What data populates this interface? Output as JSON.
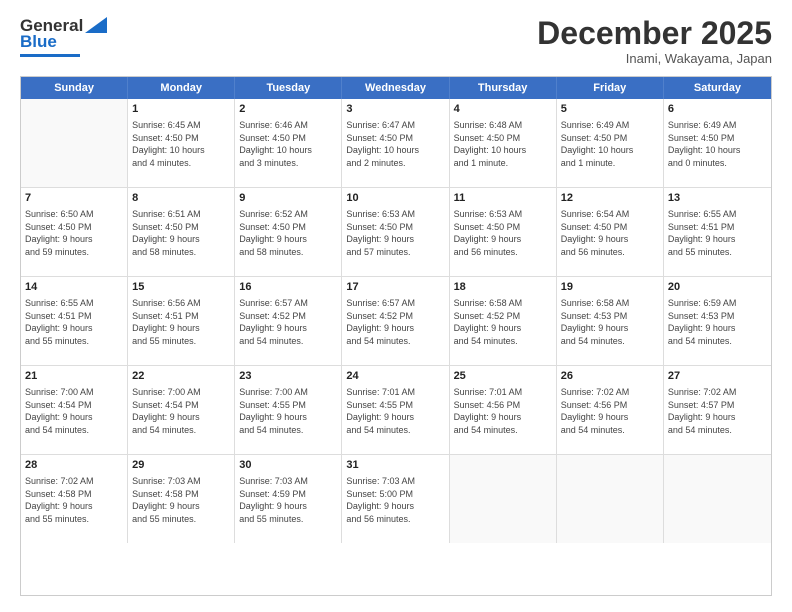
{
  "header": {
    "logo_general": "General",
    "logo_blue": "Blue",
    "month_title": "December 2025",
    "location": "Inami, Wakayama, Japan"
  },
  "weekdays": [
    "Sunday",
    "Monday",
    "Tuesday",
    "Wednesday",
    "Thursday",
    "Friday",
    "Saturday"
  ],
  "rows": [
    [
      {
        "day": "",
        "info": ""
      },
      {
        "day": "1",
        "info": "Sunrise: 6:45 AM\nSunset: 4:50 PM\nDaylight: 10 hours\nand 4 minutes."
      },
      {
        "day": "2",
        "info": "Sunrise: 6:46 AM\nSunset: 4:50 PM\nDaylight: 10 hours\nand 3 minutes."
      },
      {
        "day": "3",
        "info": "Sunrise: 6:47 AM\nSunset: 4:50 PM\nDaylight: 10 hours\nand 2 minutes."
      },
      {
        "day": "4",
        "info": "Sunrise: 6:48 AM\nSunset: 4:50 PM\nDaylight: 10 hours\nand 1 minute."
      },
      {
        "day": "5",
        "info": "Sunrise: 6:49 AM\nSunset: 4:50 PM\nDaylight: 10 hours\nand 1 minute."
      },
      {
        "day": "6",
        "info": "Sunrise: 6:49 AM\nSunset: 4:50 PM\nDaylight: 10 hours\nand 0 minutes."
      }
    ],
    [
      {
        "day": "7",
        "info": "Sunrise: 6:50 AM\nSunset: 4:50 PM\nDaylight: 9 hours\nand 59 minutes."
      },
      {
        "day": "8",
        "info": "Sunrise: 6:51 AM\nSunset: 4:50 PM\nDaylight: 9 hours\nand 58 minutes."
      },
      {
        "day": "9",
        "info": "Sunrise: 6:52 AM\nSunset: 4:50 PM\nDaylight: 9 hours\nand 58 minutes."
      },
      {
        "day": "10",
        "info": "Sunrise: 6:53 AM\nSunset: 4:50 PM\nDaylight: 9 hours\nand 57 minutes."
      },
      {
        "day": "11",
        "info": "Sunrise: 6:53 AM\nSunset: 4:50 PM\nDaylight: 9 hours\nand 56 minutes."
      },
      {
        "day": "12",
        "info": "Sunrise: 6:54 AM\nSunset: 4:50 PM\nDaylight: 9 hours\nand 56 minutes."
      },
      {
        "day": "13",
        "info": "Sunrise: 6:55 AM\nSunset: 4:51 PM\nDaylight: 9 hours\nand 55 minutes."
      }
    ],
    [
      {
        "day": "14",
        "info": "Sunrise: 6:55 AM\nSunset: 4:51 PM\nDaylight: 9 hours\nand 55 minutes."
      },
      {
        "day": "15",
        "info": "Sunrise: 6:56 AM\nSunset: 4:51 PM\nDaylight: 9 hours\nand 55 minutes."
      },
      {
        "day": "16",
        "info": "Sunrise: 6:57 AM\nSunset: 4:52 PM\nDaylight: 9 hours\nand 54 minutes."
      },
      {
        "day": "17",
        "info": "Sunrise: 6:57 AM\nSunset: 4:52 PM\nDaylight: 9 hours\nand 54 minutes."
      },
      {
        "day": "18",
        "info": "Sunrise: 6:58 AM\nSunset: 4:52 PM\nDaylight: 9 hours\nand 54 minutes."
      },
      {
        "day": "19",
        "info": "Sunrise: 6:58 AM\nSunset: 4:53 PM\nDaylight: 9 hours\nand 54 minutes."
      },
      {
        "day": "20",
        "info": "Sunrise: 6:59 AM\nSunset: 4:53 PM\nDaylight: 9 hours\nand 54 minutes."
      }
    ],
    [
      {
        "day": "21",
        "info": "Sunrise: 7:00 AM\nSunset: 4:54 PM\nDaylight: 9 hours\nand 54 minutes."
      },
      {
        "day": "22",
        "info": "Sunrise: 7:00 AM\nSunset: 4:54 PM\nDaylight: 9 hours\nand 54 minutes."
      },
      {
        "day": "23",
        "info": "Sunrise: 7:00 AM\nSunset: 4:55 PM\nDaylight: 9 hours\nand 54 minutes."
      },
      {
        "day": "24",
        "info": "Sunrise: 7:01 AM\nSunset: 4:55 PM\nDaylight: 9 hours\nand 54 minutes."
      },
      {
        "day": "25",
        "info": "Sunrise: 7:01 AM\nSunset: 4:56 PM\nDaylight: 9 hours\nand 54 minutes."
      },
      {
        "day": "26",
        "info": "Sunrise: 7:02 AM\nSunset: 4:56 PM\nDaylight: 9 hours\nand 54 minutes."
      },
      {
        "day": "27",
        "info": "Sunrise: 7:02 AM\nSunset: 4:57 PM\nDaylight: 9 hours\nand 54 minutes."
      }
    ],
    [
      {
        "day": "28",
        "info": "Sunrise: 7:02 AM\nSunset: 4:58 PM\nDaylight: 9 hours\nand 55 minutes."
      },
      {
        "day": "29",
        "info": "Sunrise: 7:03 AM\nSunset: 4:58 PM\nDaylight: 9 hours\nand 55 minutes."
      },
      {
        "day": "30",
        "info": "Sunrise: 7:03 AM\nSunset: 4:59 PM\nDaylight: 9 hours\nand 55 minutes."
      },
      {
        "day": "31",
        "info": "Sunrise: 7:03 AM\nSunset: 5:00 PM\nDaylight: 9 hours\nand 56 minutes."
      },
      {
        "day": "",
        "info": ""
      },
      {
        "day": "",
        "info": ""
      },
      {
        "day": "",
        "info": ""
      }
    ]
  ]
}
